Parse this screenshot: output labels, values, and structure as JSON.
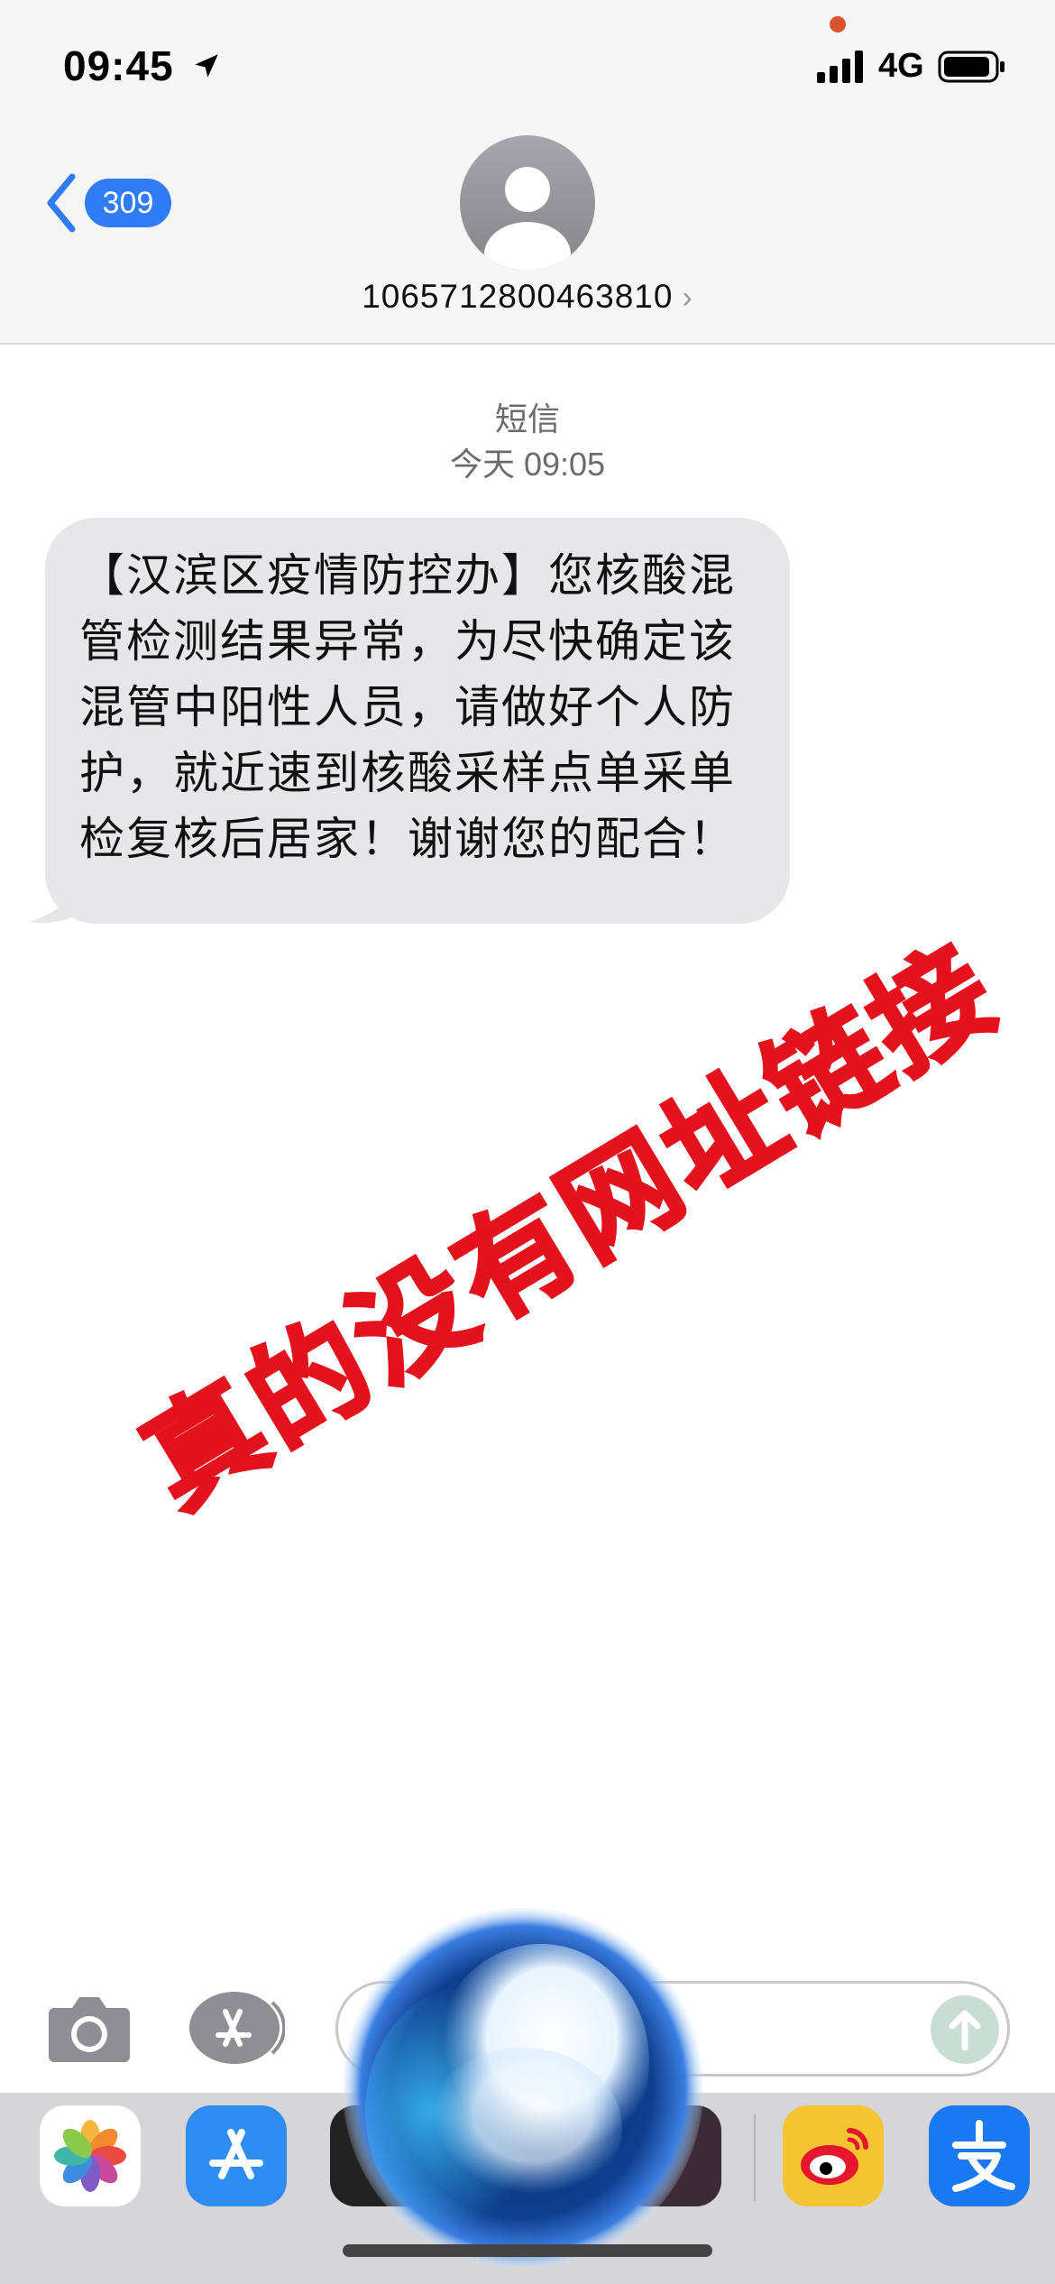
{
  "status_bar": {
    "time": "09:45",
    "network": "4G"
  },
  "nav": {
    "back_count": "309",
    "contact": "1065712800463810",
    "contact_chevron": "›"
  },
  "thread": {
    "service": "短信",
    "timestamp": "今天 09:05",
    "message": "【汉滨区疫情防控办】您核酸混管检测结果异常，为尽快确定该混管中阳性人员，请做好个人防护，就近速到核酸采样点单采单检复核后居家！谢谢您的配合！"
  },
  "overlay_text": "真的没有网址链接",
  "colors": {
    "accent_blue": "#2f7cf6",
    "bubble": "#e7e7e9",
    "watermark_red": "#e3121c",
    "dock": "#d6d6d9"
  },
  "dock_apps": [
    "photos",
    "app-store",
    "weibo",
    "alipay"
  ],
  "icons": [
    "location-arrow-icon",
    "signal-icon",
    "battery-icon",
    "chevron-left-icon",
    "avatar-icon",
    "camera-icon",
    "app-store-icon",
    "send-arrow-icon",
    "siri-icon"
  ]
}
